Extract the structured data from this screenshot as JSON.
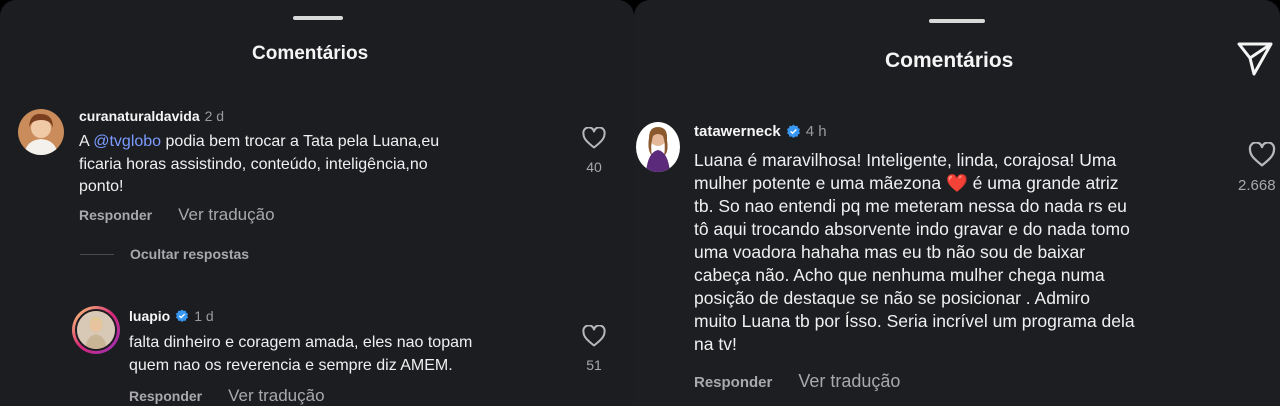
{
  "left_panel": {
    "title": "Comentários",
    "comments": [
      {
        "username": "curanaturaldavida",
        "time": "2 d",
        "mention": "@tvglobo",
        "text_line1_rest": " podia bem trocar a Tata pela Luana,eu",
        "text_line2": "ficaria horas assistindo, conteúdo, inteligência,no",
        "text_line3": "ponto!",
        "reply_label": "Responder",
        "translate_label": "Ver tradução",
        "likes": "40"
      }
    ],
    "hide_replies_label": "Ocultar respostas",
    "reply": {
      "username": "luapio",
      "verified": true,
      "time": "1 d",
      "text_line1": "falta dinheiro e coragem amada, eles nao topam",
      "text_line2": "quem nao os reverencia e sempre diz AMEM.",
      "reply_label": "Responder",
      "translate_label": "Ver tradução",
      "likes": "51"
    }
  },
  "right_panel": {
    "title": "Comentários",
    "comment": {
      "username": "tatawerneck",
      "verified": true,
      "time": "4 h",
      "lines": [
        "Luana é maravilhosa! Inteligente, linda, corajosa! Uma",
        "mulher potente e uma mãezona",
        "tb. So nao entendi pq me meteram nessa do nada rs eu",
        "tô aqui trocando absorvente indo gravar e do nada tomo",
        "uma voadora hahaha mas eu tb não sou de baixar",
        "cabeça não. Acho que nenhuma mulher chega numa",
        "posição de destaque se não se posicionar . Admiro",
        "muito Luana tb por Ísso. Seria incrível um programa dela",
        "na tv!"
      ],
      "line2_after_heart": " é uma grande atriz",
      "heart_emoji": "❤️",
      "reply_label": "Responder",
      "translate_label": "Ver tradução",
      "likes": "2.668"
    }
  },
  "icons": {
    "like": "heart-outline-icon",
    "send": "paper-plane-icon",
    "verified": "verified-badge-icon"
  },
  "colors": {
    "background": "#1c1d21",
    "mention": "#7b9bff",
    "verified": "#3897f0",
    "secondary_text": "#a8a8ad"
  }
}
